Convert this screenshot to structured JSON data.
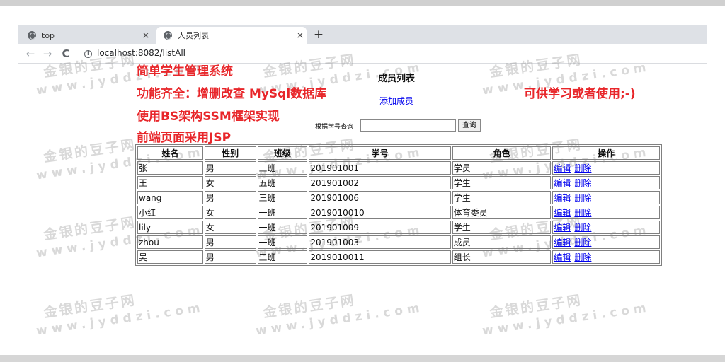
{
  "browser": {
    "tabs": [
      {
        "title": "top",
        "close": "×"
      },
      {
        "title": "人员列表",
        "close": "×"
      }
    ],
    "new_tab": "+",
    "nav": {
      "back": "←",
      "forward": "→",
      "reload": "C"
    },
    "url": "localhost:8082/listAll"
  },
  "watermark": {
    "line1": "金银的豆子网",
    "line2": "www.jyddzi.com"
  },
  "annotations": [
    "简单学生管理系统",
    "功能齐全：增删改查 MySql数据库",
    "使用BS架构SSM框架实现",
    "前端页面采用JSP",
    "可供学习或者使用;-)"
  ],
  "page": {
    "title": "成员列表",
    "add_link": "添加成员",
    "search": {
      "label": "根据学号查询",
      "value": "",
      "button": "查询"
    }
  },
  "table": {
    "headers": [
      "姓名",
      "性别",
      "班级",
      "学号",
      "角色",
      "操作"
    ],
    "rows": [
      [
        "张",
        "男",
        "三班",
        "201901001",
        "学员"
      ],
      [
        "王",
        "女",
        "五班",
        "201901002",
        "学生"
      ],
      [
        "wang",
        "男",
        "三班",
        "201901006",
        "学生"
      ],
      [
        "小红",
        "女",
        "一班",
        "2019010010",
        "体育委员"
      ],
      [
        "lily",
        "女",
        "一班",
        "201901009",
        "学生"
      ],
      [
        "zhou",
        "男",
        "一班",
        "201901003",
        "成员"
      ],
      [
        "吴",
        "男",
        "三班",
        "2019010011",
        "组长"
      ]
    ],
    "actions": {
      "edit": "编辑",
      "delete": "删除"
    }
  },
  "colors": {
    "annotation_red": "#e8262a",
    "link_blue": "#0000ee"
  }
}
